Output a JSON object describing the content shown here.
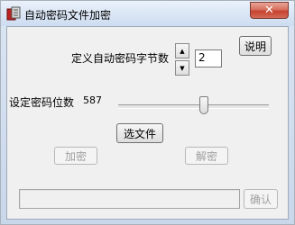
{
  "window": {
    "title": "自动密码文件加密",
    "close_symbol": "✕"
  },
  "form": {
    "byte_count_label": "定义自动密码字节数",
    "byte_count_value": "2",
    "spin_up_symbol": "▲",
    "spin_down_symbol": "▼",
    "help_button": "说明",
    "digits_label": "设定密码位数",
    "digits_value": "587",
    "slider_value": 587,
    "select_file_button": "选文件",
    "encrypt_button": "加密",
    "decrypt_button": "解密",
    "status_text": "",
    "confirm_button": "确认"
  },
  "colors": {
    "titlebar": "#dde8f6",
    "client_bg": "#f0f0f0",
    "close_button": "#c7432f",
    "disabled_text": "#a0a0a0"
  }
}
